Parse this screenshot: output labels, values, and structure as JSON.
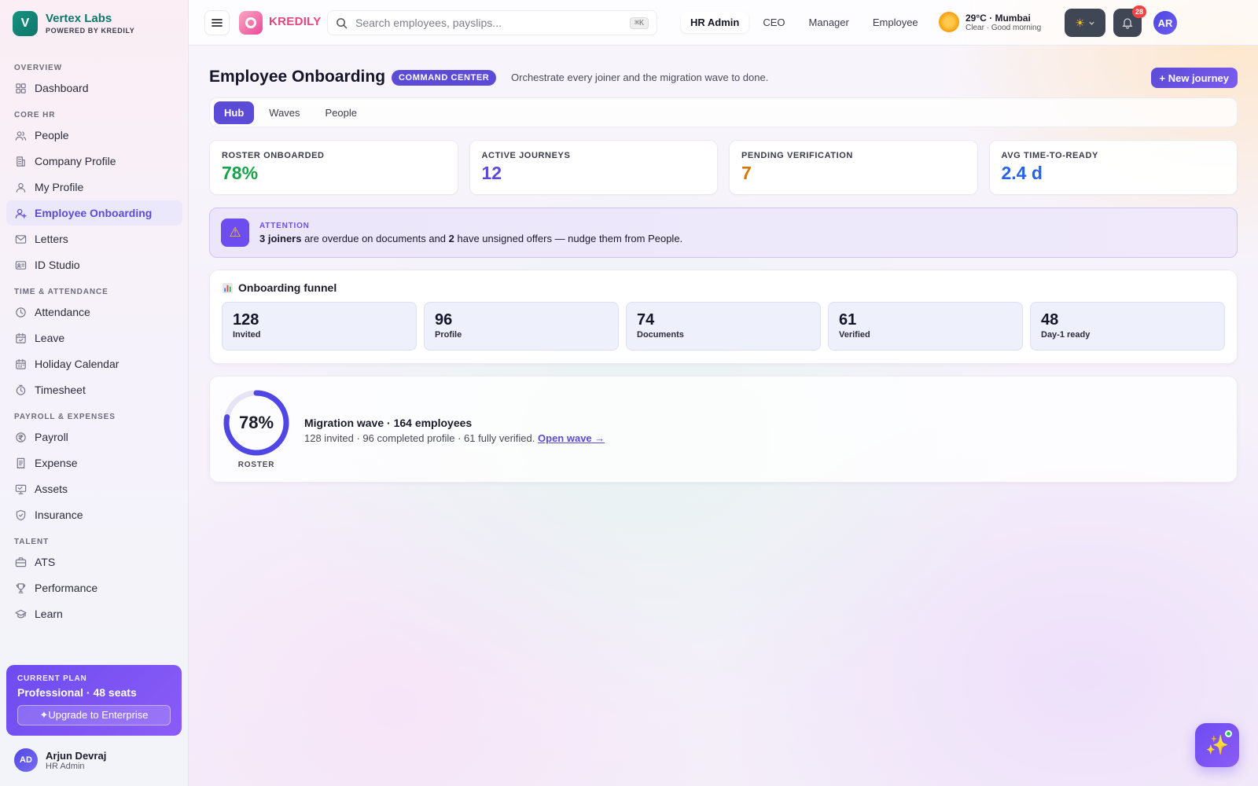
{
  "brand": {
    "name": "Vertex Labs",
    "tagline": "POWERED BY KREDILY",
    "logo_letter": "V"
  },
  "sidebar": {
    "sections": [
      {
        "title": "OVERVIEW",
        "items": [
          {
            "label": "Dashboard",
            "icon": "grid-icon"
          }
        ]
      },
      {
        "title": "CORE HR",
        "items": [
          {
            "label": "People",
            "icon": "users-icon"
          },
          {
            "label": "Company Profile",
            "icon": "building-icon"
          },
          {
            "label": "My Profile",
            "icon": "user-icon"
          },
          {
            "label": "Employee Onboarding",
            "icon": "user-plus-icon",
            "active": true
          },
          {
            "label": "Letters",
            "icon": "mail-icon"
          },
          {
            "label": "ID Studio",
            "icon": "id-card-icon"
          }
        ]
      },
      {
        "title": "TIME & ATTENDANCE",
        "items": [
          {
            "label": "Attendance",
            "icon": "clock-icon"
          },
          {
            "label": "Leave",
            "icon": "calendar-icon"
          },
          {
            "label": "Holiday Calendar",
            "icon": "calendar-days-icon"
          },
          {
            "label": "Timesheet",
            "icon": "timer-icon"
          }
        ]
      },
      {
        "title": "PAYROLL & EXPENSES",
        "items": [
          {
            "label": "Payroll",
            "icon": "rupee-icon"
          },
          {
            "label": "Expense",
            "icon": "receipt-icon"
          },
          {
            "label": "Assets",
            "icon": "monitor-icon"
          },
          {
            "label": "Insurance",
            "icon": "shield-icon"
          }
        ]
      },
      {
        "title": "TALENT",
        "items": [
          {
            "label": "ATS",
            "icon": "briefcase-icon"
          },
          {
            "label": "Performance",
            "icon": "trophy-icon"
          },
          {
            "label": "Learn",
            "icon": "graduation-cap-icon"
          }
        ]
      }
    ]
  },
  "plan": {
    "label": "CURRENT PLAN",
    "name": "Professional · 48 seats",
    "upgrade_label": "✦Upgrade to Enterprise"
  },
  "user": {
    "initials": "AD",
    "name": "Arjun Devraj",
    "role": "HR Admin"
  },
  "topbar": {
    "app_name": "KREDILY",
    "search": {
      "placeholder": "Search employees, payslips...",
      "shortcut": "⌘K"
    },
    "roles": [
      {
        "label": "HR Admin",
        "active": true
      },
      {
        "label": "CEO"
      },
      {
        "label": "Manager"
      },
      {
        "label": "Employee"
      }
    ],
    "weather": {
      "main": "29°C · Mumbai",
      "sub": "Clear · Good morning"
    },
    "theme_icon": "☀",
    "notifications": "28",
    "avatar_initials": "AR"
  },
  "page": {
    "title": "Employee Onboarding",
    "pill": "COMMAND CENTER",
    "subtitle": "Orchestrate every joiner and the migration wave to done.",
    "new_button": "+ New journey",
    "tabs": [
      {
        "label": "Hub",
        "active": true
      },
      {
        "label": "Waves"
      },
      {
        "label": "People"
      }
    ]
  },
  "kpis": [
    {
      "label": "ROSTER ONBOARDED",
      "value": "78%",
      "color": "#16a34a"
    },
    {
      "label": "ACTIVE JOURNEYS",
      "value": "12",
      "color": "#5b4bd6"
    },
    {
      "label": "PENDING VERIFICATION",
      "value": "7",
      "color": "#d97706"
    },
    {
      "label": "AVG TIME-TO-READY",
      "value": "2.4 d",
      "color": "#2563eb"
    }
  ],
  "attention": {
    "label": "ATTENTION",
    "count_overdue": "3 joiners",
    "text_1": " are overdue on documents and ",
    "count_unsigned": "2",
    "text_2": " have unsigned offers — nudge them from People."
  },
  "funnel": {
    "title": "Onboarding funnel",
    "stages": [
      {
        "value": "128",
        "label": "Invited"
      },
      {
        "value": "96",
        "label": "Profile"
      },
      {
        "value": "74",
        "label": "Documents"
      },
      {
        "value": "61",
        "label": "Verified"
      },
      {
        "value": "48",
        "label": "Day-1 ready"
      }
    ]
  },
  "wave": {
    "ring_value": "78%",
    "ring_fraction": 0.78,
    "ring_label": "ROSTER",
    "title": "Migration wave · 164 employees",
    "desc": "128 invited · 96 completed profile · 61 fully verified.",
    "link": "Open wave →"
  },
  "colors": {
    "accent": "#5b4bd6",
    "brand_teal": "#0f766e",
    "kredily_pink": "#e2477c"
  }
}
